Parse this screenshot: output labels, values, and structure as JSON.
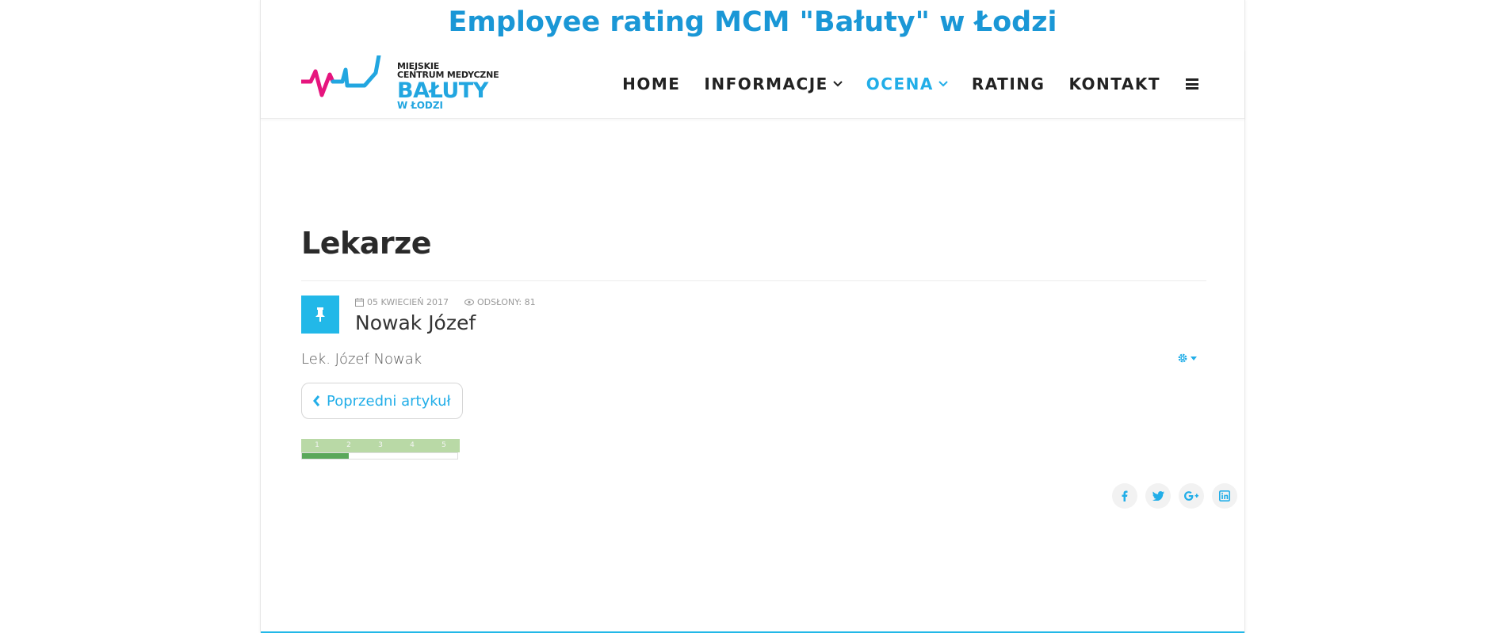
{
  "banner": {
    "title": "Employee rating MCM \"Bałuty\" w Łodzi"
  },
  "logo": {
    "line1": "MIEJSKIE",
    "line2": "CENTRUM MEDYCZNE",
    "line3": "BAŁUTY",
    "line4": "W ŁODZI"
  },
  "nav": {
    "items": [
      {
        "label": "HOME",
        "dropdown": false,
        "active": false
      },
      {
        "label": "INFORMACJE",
        "dropdown": true,
        "active": false
      },
      {
        "label": "OCENA",
        "dropdown": true,
        "active": true
      },
      {
        "label": "RATING",
        "dropdown": false,
        "active": false
      },
      {
        "label": "KONTAKT",
        "dropdown": false,
        "active": false
      }
    ],
    "menu_icon": "hamburger-icon"
  },
  "main": {
    "page_title": "Lekarze",
    "article": {
      "pin_icon": "thumbtack-icon",
      "date": "05 KWIECIEŃ 2017",
      "views": "ODSŁONY: 81",
      "title": "Nowak Józef",
      "intro": "Lek. Józef Nowak",
      "tools_icon": "gear-icon"
    },
    "prev_button": "Poprzedni artykuł",
    "rating": {
      "scale": [
        "1",
        "2",
        "3",
        "4",
        "5"
      ],
      "level_fraction": 0.3
    },
    "share": [
      "facebook-icon",
      "twitter-icon",
      "google-plus-icon",
      "linkedin-icon"
    ]
  },
  "colors": {
    "accent": "#22b8e8",
    "banner": "#1a97d6",
    "logo_pink": "#e6157e",
    "rating_fill": "#5aa85a"
  }
}
